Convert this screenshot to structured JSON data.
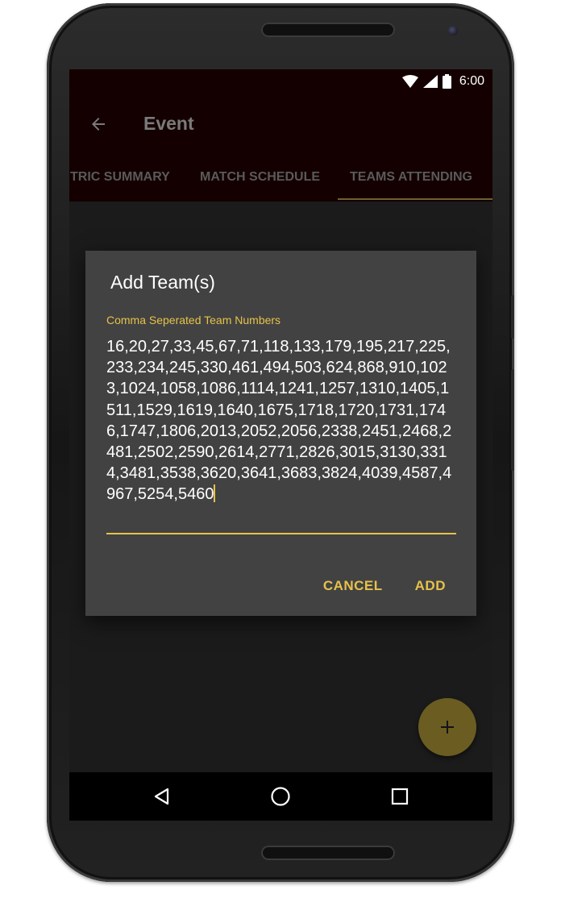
{
  "status_bar": {
    "time": "6:00"
  },
  "toolbar": {
    "title": "Event"
  },
  "tabs": [
    {
      "label": "TRIC SUMMARY",
      "selected": false
    },
    {
      "label": "MATCH SCHEDULE",
      "selected": false
    },
    {
      "label": "TEAMS ATTENDING",
      "selected": true
    }
  ],
  "dialog": {
    "title": "Add Team(s)",
    "input_label": "Comma Seperated Team Numbers",
    "input_value": "16,20,27,33,45,67,71,118,133,179,195,217,225,233,234,245,330,461,494,503,624,868,910,1023,1024,1058,1086,1114,1241,1257,1310,1405,1511,1529,1619,1640,1675,1718,1720,1731,1746,1747,1806,2013,2052,2056,2338,2451,2468,2481,2502,2590,2614,2771,2826,3015,3130,3314,3481,3538,3620,3641,3683,3824,4039,4587,4967,5254,5460",
    "cancel_label": "CANCEL",
    "add_label": "ADD"
  },
  "fab": {
    "icon": "plus-icon"
  },
  "nav_bar": {
    "icons": [
      "back-triangle-icon",
      "home-circle-icon",
      "recents-square-icon"
    ]
  },
  "colors": {
    "accent": "#e6c24a",
    "appbar": "#140000",
    "dialog_bg": "#424242",
    "screen_bg": "#1b1b1b",
    "fab": "#6b5c22"
  }
}
